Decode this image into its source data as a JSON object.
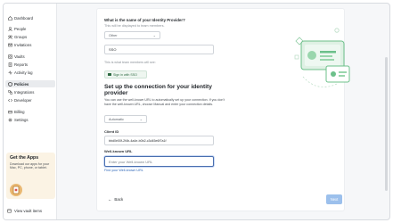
{
  "sidebar": {
    "items": [
      {
        "label": "Dashboard",
        "icon": "home-icon"
      },
      {
        "label": "People",
        "icon": "person-icon"
      },
      {
        "label": "Groups",
        "icon": "groups-icon"
      },
      {
        "label": "Invitations",
        "icon": "mail-icon"
      },
      {
        "label": "Vaults",
        "icon": "vault-icon"
      },
      {
        "label": "Reports",
        "icon": "reports-icon"
      },
      {
        "label": "Activity log",
        "icon": "activity-icon"
      },
      {
        "label": "Policies",
        "icon": "policies-icon"
      },
      {
        "label": "Integrations",
        "icon": "integrations-icon"
      },
      {
        "label": "Developer",
        "icon": "developer-icon"
      },
      {
        "label": "Billing",
        "icon": "billing-icon"
      },
      {
        "label": "Settings",
        "icon": "gear-icon"
      }
    ],
    "active_item": "Policies",
    "promo": {
      "title": "Get the Apps",
      "text": "Download our apps for your Mac, PC, phone, or tablet."
    },
    "footer_label": "View vault items"
  },
  "form": {
    "provider_question": "What is the name of your Identity Provider?",
    "provider_help": "This will be displayed to team members.",
    "provider_select_value": "Other",
    "provider_name_value": "SSO",
    "preview_help": "This is what team members will see:",
    "sso_button_label": "Sign in with SSO",
    "section_title": "Set up the connection for your identity provider",
    "section_desc": "You can use the well-known URL to automatically set up your connection. If you don't have the well-known URL, choose Manual and enter your connection details.",
    "mode_select_value": "Automatic",
    "client_id_label": "Client ID",
    "client_id_value": "bbd0e00f-2f4b-4a4e-b0b2-c3d45e6f7a1f",
    "well_known_label": "Well-known URL",
    "well_known_placeholder": "Enter your Well-known URL",
    "find_link": "Find your Well-known URL",
    "back_label": "Back",
    "next_label": "Next"
  },
  "colors": {
    "accent": "#2f67b8",
    "next_button": "#9cc0ec",
    "sso_green": "#2e6a42",
    "promo_bg": "#fbf3e4"
  }
}
